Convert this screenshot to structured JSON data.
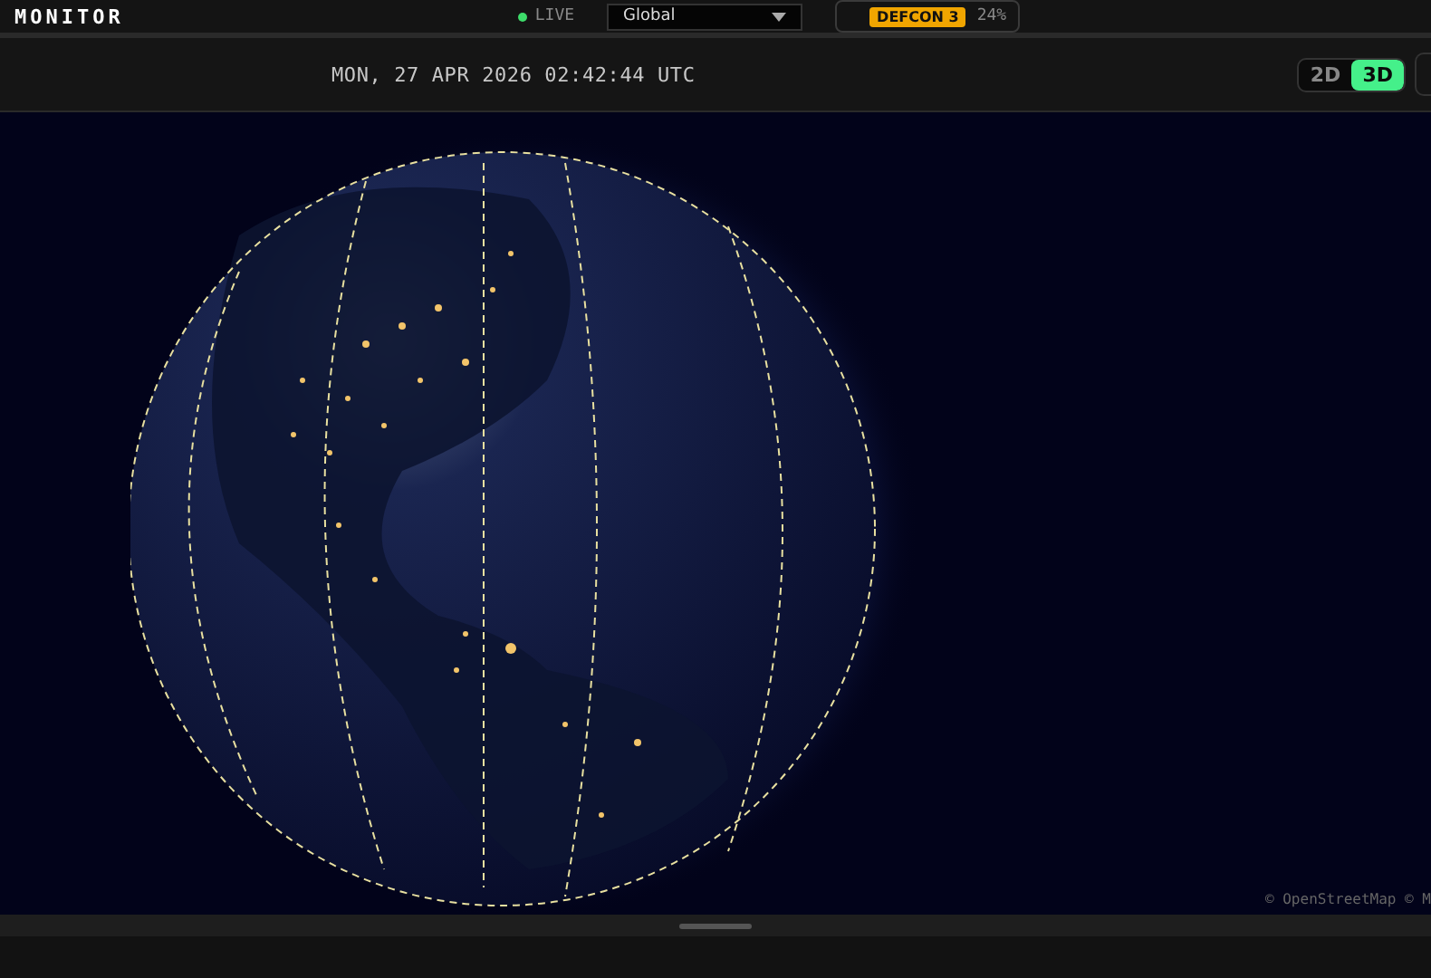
{
  "header": {
    "logo": "MONITOR",
    "live": {
      "label": "LIVE",
      "on": true
    },
    "region_select": {
      "value": "Global"
    },
    "defcon": {
      "label": "DEFCON 3",
      "percent": "24%"
    }
  },
  "toolbar": {
    "datetime": "MON, 27 APR 2026 02:42:44 UTC",
    "view_toggle": [
      {
        "label": "2D",
        "selected": false
      },
      {
        "label": "3D",
        "selected": true
      }
    ]
  },
  "map": {
    "attribution": "© OpenStreetMap © M"
  }
}
